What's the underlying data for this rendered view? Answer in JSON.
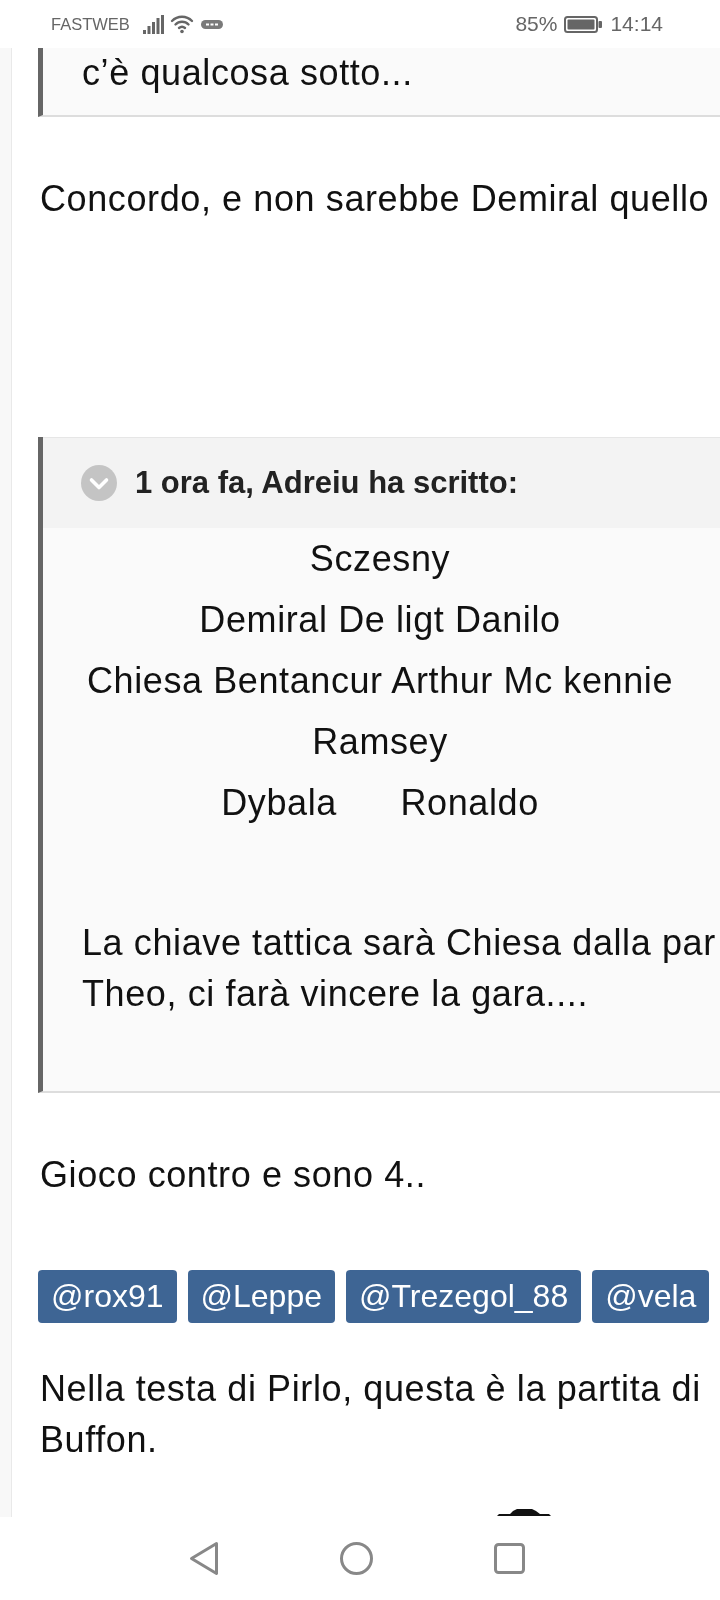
{
  "status_bar": {
    "carrier": "FASTWEB",
    "battery": "85%",
    "time": "14:14"
  },
  "post": [
    {
      "kind": "quote_end",
      "text": "c’è qualcosa sotto..."
    },
    {
      "kind": "paragraph",
      "lines": [
        "Concordo, e non sarebbe Demiral quello"
      ]
    },
    {
      "kind": "quote",
      "citation": "1 ora fa, Adreiu ha scritto:",
      "lineup": [
        "Sczesny",
        "Demiral De ligt Danilo",
        "Chiesa Bentancur Arthur Mc kennie",
        "Ramsey",
        "Dybala      Ronaldo"
      ],
      "lines": [
        "La chiave tattica sarà Chiesa dalla par",
        "Theo, ci farà vincere la gara...."
      ]
    },
    {
      "kind": "paragraph",
      "lines": [
        "Gioco contro e sono 4.."
      ]
    },
    {
      "kind": "mentions",
      "items": [
        "@rox91",
        "@Leppe",
        "@Trezegol_88",
        "@vela"
      ]
    },
    {
      "kind": "paragraph",
      "lines": [
        "Nella testa di Pirlo, questa è la partita di",
        "Buffon."
      ]
    },
    {
      "kind": "image"
    }
  ]
}
